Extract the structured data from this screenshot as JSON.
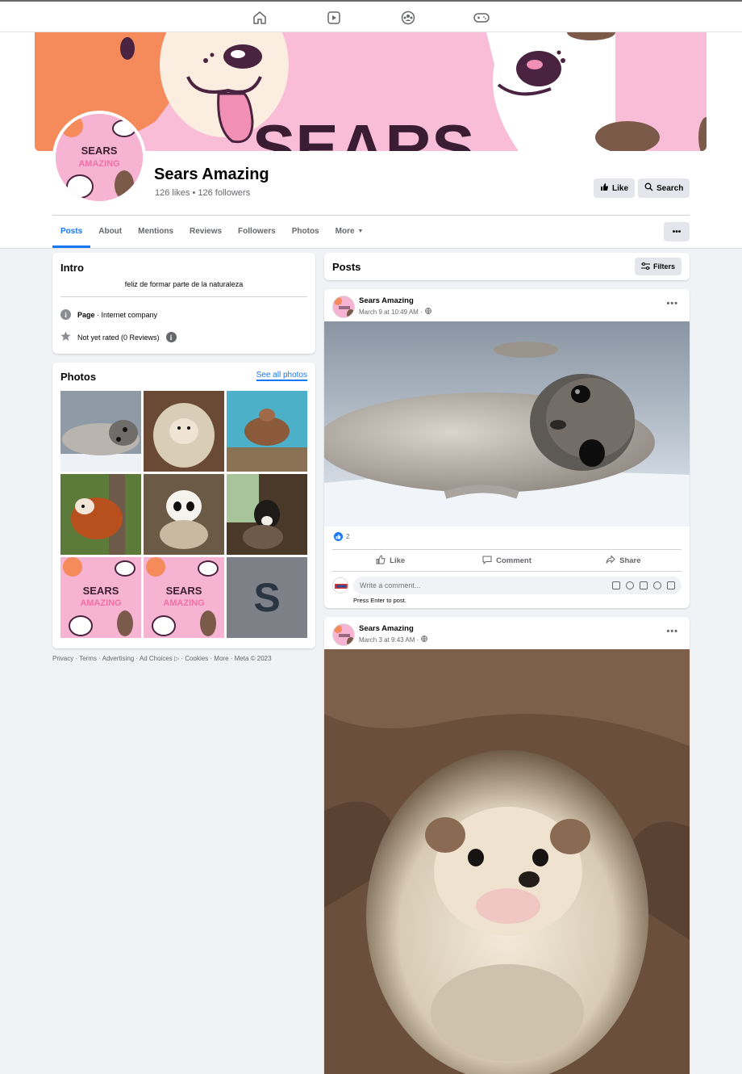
{
  "nav": {
    "icons": [
      "home-icon",
      "video-icon",
      "groups-icon",
      "gaming-icon"
    ]
  },
  "page": {
    "name": "Sears Amazing",
    "stats": "126 likes • 126 followers",
    "cover_text": "SEARS",
    "avatar_text_1": "SEARS",
    "avatar_text_2": "AMAZING"
  },
  "header_buttons": {
    "like": "Like",
    "search": "Search",
    "more_dots": "•••"
  },
  "tabs": [
    {
      "label": "Posts",
      "active": true
    },
    {
      "label": "About"
    },
    {
      "label": "Mentions"
    },
    {
      "label": "Reviews"
    },
    {
      "label": "Followers"
    },
    {
      "label": "Photos"
    },
    {
      "label": "More"
    }
  ],
  "intro": {
    "title": "Intro",
    "bio": "feliz de formar parte de la naturaleza",
    "category_bold": "Page",
    "category_rest": " · Internet company",
    "rating": "Not yet rated (0 Reviews)"
  },
  "photos": {
    "title": "Photos",
    "see_all": "See all photos",
    "items": [
      "seal",
      "hedgehog",
      "turtle",
      "red panda",
      "panda",
      "dog",
      "sears-logo",
      "sears-logo",
      "s-letter"
    ],
    "s_letter": "S"
  },
  "footer": "Privacy · Terms · Advertising · Ad Choices ▷ · Cookies · More · Meta © 2023",
  "posts": {
    "title": "Posts",
    "filters": "Filters",
    "items": [
      {
        "author": "Sears Amazing",
        "date": "March 9 at 10:49 AM ·",
        "likes": "2"
      },
      {
        "author": "Sears Amazing",
        "date": "March 3 at 9:43 AM ·"
      }
    ]
  },
  "post_actions": {
    "like": "Like",
    "comment": "Comment",
    "share": "Share"
  },
  "comment": {
    "placeholder": "Write a comment...",
    "hint": "Press Enter to post."
  },
  "colors": {
    "accent": "#1877f2",
    "brand_pink": "#f7b3d2",
    "background": "#f0f2f5"
  }
}
